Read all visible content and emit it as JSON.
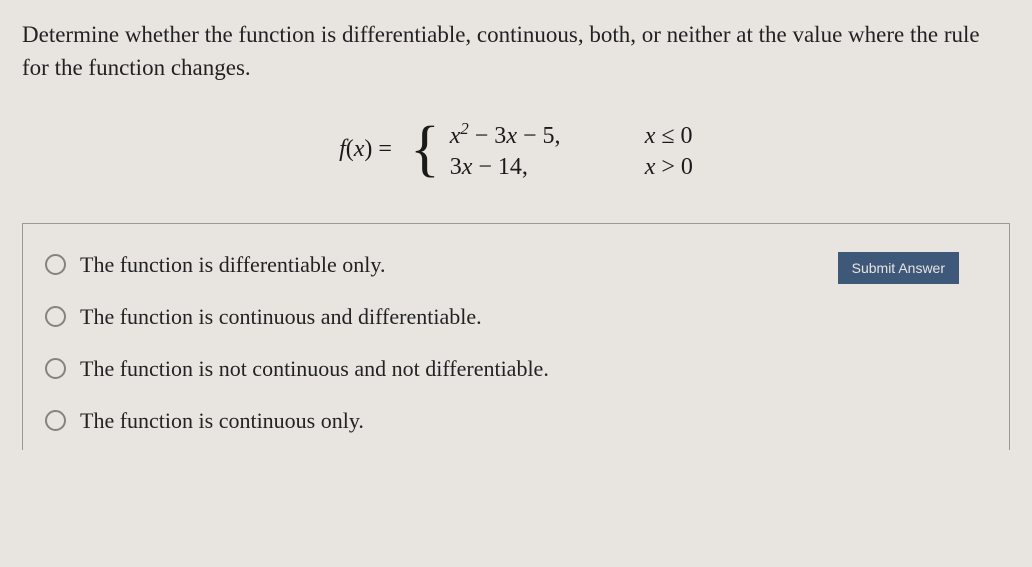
{
  "question": "Determine whether the function is differentiable, continuous, both, or neither at the value where the rule for the function changes.",
  "equation": {
    "lhs": "f(x) =",
    "case1_expr": "x² − 3x − 5,",
    "case1_cond": "x ≤ 0",
    "case2_expr": "3x − 14,",
    "case2_cond": "x > 0"
  },
  "options": [
    "The function is differentiable only.",
    "The function is continuous and differentiable.",
    "The function is not continuous and not differentiable.",
    "The function is continuous only."
  ],
  "submit_label": "Submit Answer"
}
